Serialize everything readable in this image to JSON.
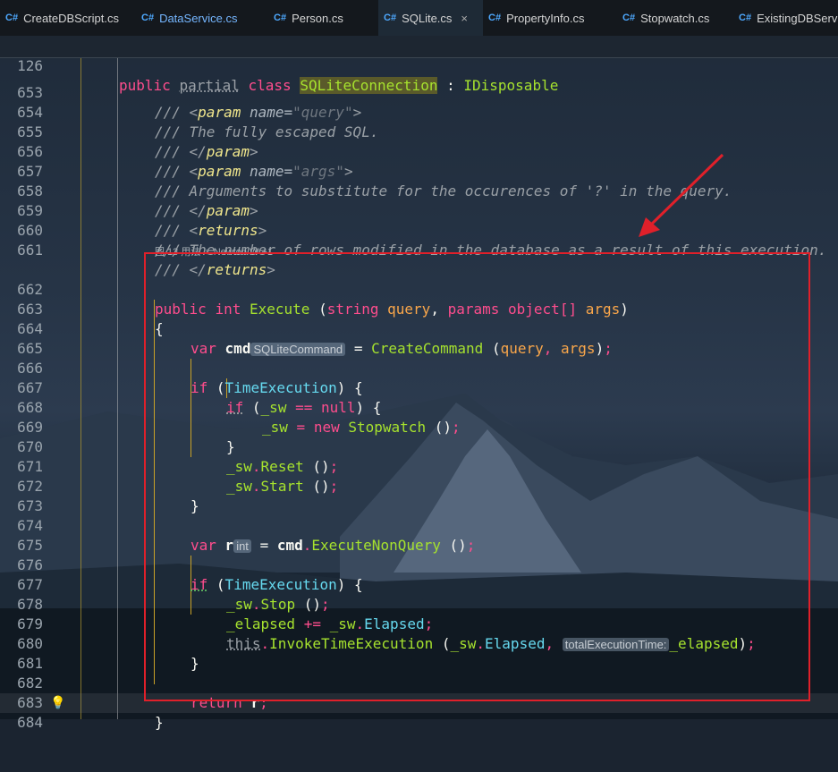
{
  "tabs": [
    {
      "lang": "C#",
      "name": "CreateDBScript.cs",
      "active": false
    },
    {
      "lang": "C#",
      "name": "DataService.cs",
      "active": false
    },
    {
      "lang": "C#",
      "name": "Person.cs",
      "active": false
    },
    {
      "lang": "C#",
      "name": "SQLite.cs",
      "active": true,
      "close": "×"
    },
    {
      "lang": "C#",
      "name": "PropertyInfo.cs",
      "active": false
    },
    {
      "lang": "C#",
      "name": "Stopwatch.cs",
      "active": false
    },
    {
      "lang": "C#",
      "name": "ExistingDBServ",
      "active": false
    }
  ],
  "sticky": {
    "line": "126",
    "t1": "public",
    "t2": "partial",
    "t3": "class",
    "t4": "SQLiteConnection",
    "t5": ":",
    "t6": "IDisposable"
  },
  "codelens": "图 13 用法   ♀ Newton W +1",
  "hints": {
    "cmd_type": "SQLiteCommand",
    "r_type": "int",
    "total": "totalExecutionTime:"
  },
  "lines": {
    "l653": "653",
    "l654": "654",
    "l655": "655",
    "l656": "656",
    "l657": "657",
    "l658": "658",
    "l659": "659",
    "l660": "660",
    "l661": "661",
    "l662": "662",
    "l663": "663",
    "l664": "664",
    "l665": "665",
    "l666": "666",
    "l667": "667",
    "l668": "668",
    "l669": "669",
    "l670": "670",
    "l671": "671",
    "l672": "672",
    "l673": "673",
    "l674": "674",
    "l675": "675",
    "l676": "676",
    "l677": "677",
    "l678": "678",
    "l679": "679",
    "l680": "680",
    "l681": "681",
    "l682": "682",
    "l683": "683",
    "l684": "684"
  },
  "text": {
    "c653a": "/// <",
    "c653b": "param",
    "c653c": " name=",
    "c653d": "\"query\"",
    "c653e": ">",
    "c654": "/// The fully escaped SQL.",
    "c655a": "/// </",
    "c655b": "param",
    "c655c": ">",
    "c656a": "/// <",
    "c656b": "param",
    "c656c": " name=",
    "c656d": "\"args\"",
    "c656e": ">",
    "c657": "/// Arguments to substitute for the occurences of '?' in the query.",
    "c658a": "/// </",
    "c658b": "param",
    "c658c": ">",
    "c659a": "/// <",
    "c659b": "returns",
    "c659c": ">",
    "c660": "/// The number of rows modified in the database as a result of this execution.",
    "c661a": "/// </",
    "c661b": "returns",
    "c661c": ">",
    "public": "public",
    "int": "int",
    "Execute": "Execute",
    "string": "string",
    "query": "query",
    "params": "params",
    "object": "object[]",
    "args": "args",
    "var": "var",
    "cmd": "cmd",
    "CreateCommand": "CreateCommand",
    "if": "if",
    "TimeExecution": "TimeExecution",
    "_sw": "_sw",
    "null": "null",
    "new": "new",
    "Stopwatch": "Stopwatch",
    "Reset": "Reset",
    "Start": "Start",
    "r": "r",
    "ExecuteNonQuery": "ExecuteNonQuery",
    "Stop": "Stop",
    "_elapsed": "_elapsed",
    "Elapsed": "Elapsed",
    "this": "this",
    "InvokeTimeExecution": "InvokeTimeExecution",
    "return": "return"
  },
  "colors": {
    "keyword": "#ff4d8d",
    "function": "#a6e22e",
    "param": "#f9a64a",
    "box": "#e0202a"
  }
}
